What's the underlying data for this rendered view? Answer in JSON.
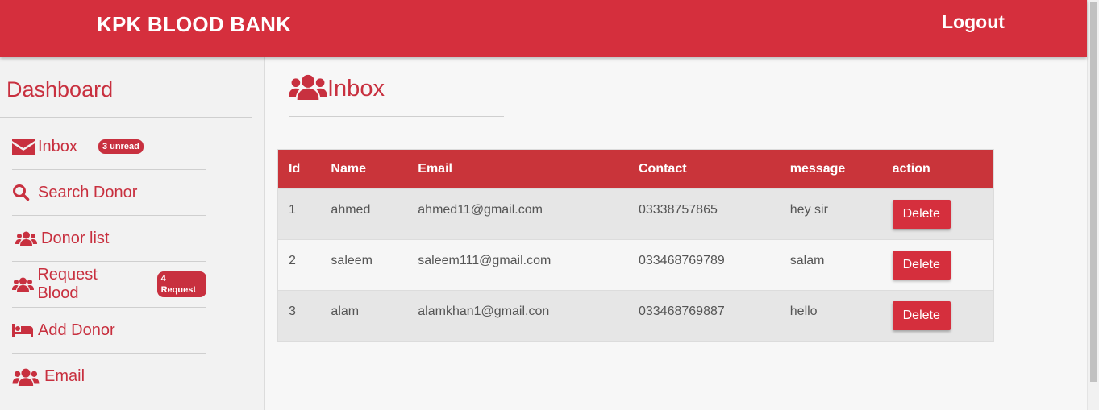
{
  "header": {
    "brand": "KPK BLOOD BANK",
    "logout_label": "Logout"
  },
  "sidebar": {
    "title": "Dashboard",
    "items": [
      {
        "label": "Inbox",
        "icon": "envelope-icon",
        "badge": "3 unread"
      },
      {
        "label": "Search Donor",
        "icon": "search-icon"
      },
      {
        "label": "Donor list",
        "icon": "users-icon"
      },
      {
        "label": "Request Blood",
        "icon": "users-icon",
        "badge": "4 Request"
      },
      {
        "label": "Add Donor",
        "icon": "bed-icon"
      },
      {
        "label": "Email",
        "icon": "users-icon"
      }
    ]
  },
  "main": {
    "title": "Inbox",
    "icon": "users-icon",
    "table": {
      "columns": [
        "Id",
        "Name",
        "Email",
        "Contact",
        "message",
        "action"
      ],
      "rows": [
        {
          "id": "1",
          "name": "ahmed",
          "email": "ahmed11@gmail.com",
          "contact": "03338757865",
          "message": "hey sir",
          "action": "Delete"
        },
        {
          "id": "2",
          "name": "saleem",
          "email": "saleem111@gmail.com",
          "contact": "033468769789",
          "message": "salam",
          "action": "Delete"
        },
        {
          "id": "3",
          "name": "alam",
          "email": "alamkhan1@gmail.con",
          "contact": "033468769887",
          "message": "hello",
          "action": "Delete"
        }
      ]
    }
  },
  "colors": {
    "primary": "#d52f3d",
    "accent_text": "#c8303f"
  }
}
